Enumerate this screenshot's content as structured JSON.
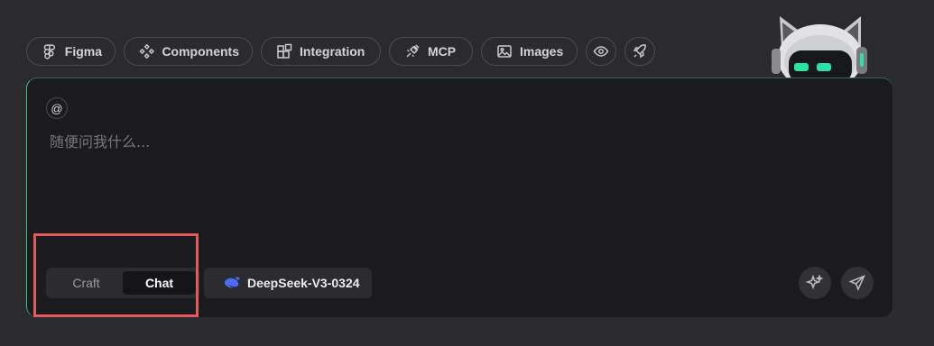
{
  "chips": [
    {
      "label": "Figma",
      "icon": "figma-icon"
    },
    {
      "label": "Components",
      "icon": "components-icon"
    },
    {
      "label": "Integration",
      "icon": "integration-icon"
    },
    {
      "label": "MCP",
      "icon": "plug-icon"
    },
    {
      "label": "Images",
      "icon": "image-icon"
    }
  ],
  "chip_icons_only": [
    "eye-icon",
    "rocket-icon"
  ],
  "composer": {
    "mention_symbol": "@",
    "placeholder": "随便问我什么...",
    "value": ""
  },
  "mode_toggle": {
    "options": [
      "Craft",
      "Chat"
    ],
    "selected": "Chat"
  },
  "model": {
    "name": "DeepSeek-V3-0324",
    "icon": "deepseek-whale-icon"
  },
  "actions": {
    "enhance_icon": "sparkle-icon",
    "send_icon": "send-icon"
  },
  "colors": {
    "accent_border": "#3fbf8a",
    "highlight": "#e85a5a",
    "panel": "#1b1a1e",
    "background": "#2b2b2e",
    "model_icon": "#4d6bfe"
  }
}
